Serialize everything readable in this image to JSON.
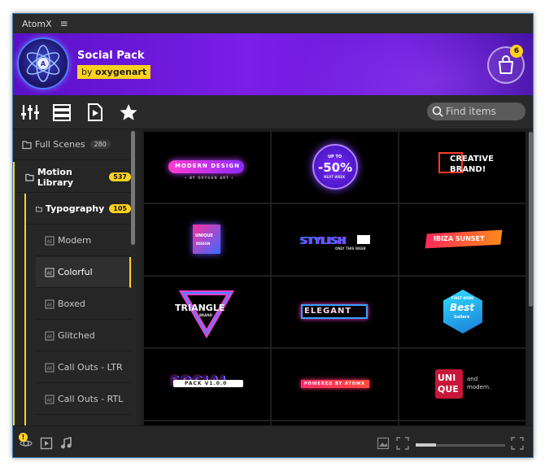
{
  "window": {
    "title": "AtomX",
    "menu_glyph": "≡"
  },
  "banner": {
    "pack_title": "Social Pack",
    "author_prefix": "by",
    "author_name": "oxygenart",
    "cart_count": "6"
  },
  "toolbar": {
    "search_placeholder": "Find items"
  },
  "sidebar": {
    "items": [
      {
        "label": "Full Scenes",
        "count": "280",
        "level": 0
      },
      {
        "label": "Motion Library",
        "count": "537",
        "level": 0,
        "expanded": true
      },
      {
        "label": "Typography",
        "count": "105",
        "level": 1,
        "expanded": true
      },
      {
        "label": "Modern",
        "level": 2
      },
      {
        "label": "Colorful",
        "level": 2,
        "selected": true
      },
      {
        "label": "Boxed",
        "level": 2
      },
      {
        "label": "Glitched",
        "level": 2
      },
      {
        "label": "Call Outs - LTR",
        "level": 2
      },
      {
        "label": "Call Outs - RTL",
        "level": 2
      }
    ]
  },
  "tiles": [
    {
      "line1": "MODERN DESIGN",
      "line2": "• BY OXYGEN ART •"
    },
    {
      "line1": "UP TO",
      "line2": "-50%",
      "line3": "NEXT WEEK"
    },
    {
      "line1": "CREATIVE",
      "line2": "BRAND!"
    },
    {
      "line1": "UNIQUE",
      "line2": "DESIGN"
    },
    {
      "line1": "STYLISH",
      "line2": "ONLY THIS WEEK"
    },
    {
      "line1": "IBIZA SUNSET"
    },
    {
      "line1": "TRIANGLE",
      "line2": "BRAND"
    },
    {
      "line1": "ELEGANT"
    },
    {
      "line1": "FIRST WEEK",
      "line2": "Best",
      "line3": "Sellers"
    },
    {
      "line1": "SOCIAL",
      "line2": "PACK V1.0.0"
    },
    {
      "line1": "POWERED BY ATOMX"
    },
    {
      "line1": "UNI",
      "line2": "QUE",
      "line3": "and",
      "line4": "modern."
    }
  ],
  "colors": {
    "accent": "#ffd21e",
    "banner_purple": "#6b17d8",
    "background": "#232323"
  }
}
